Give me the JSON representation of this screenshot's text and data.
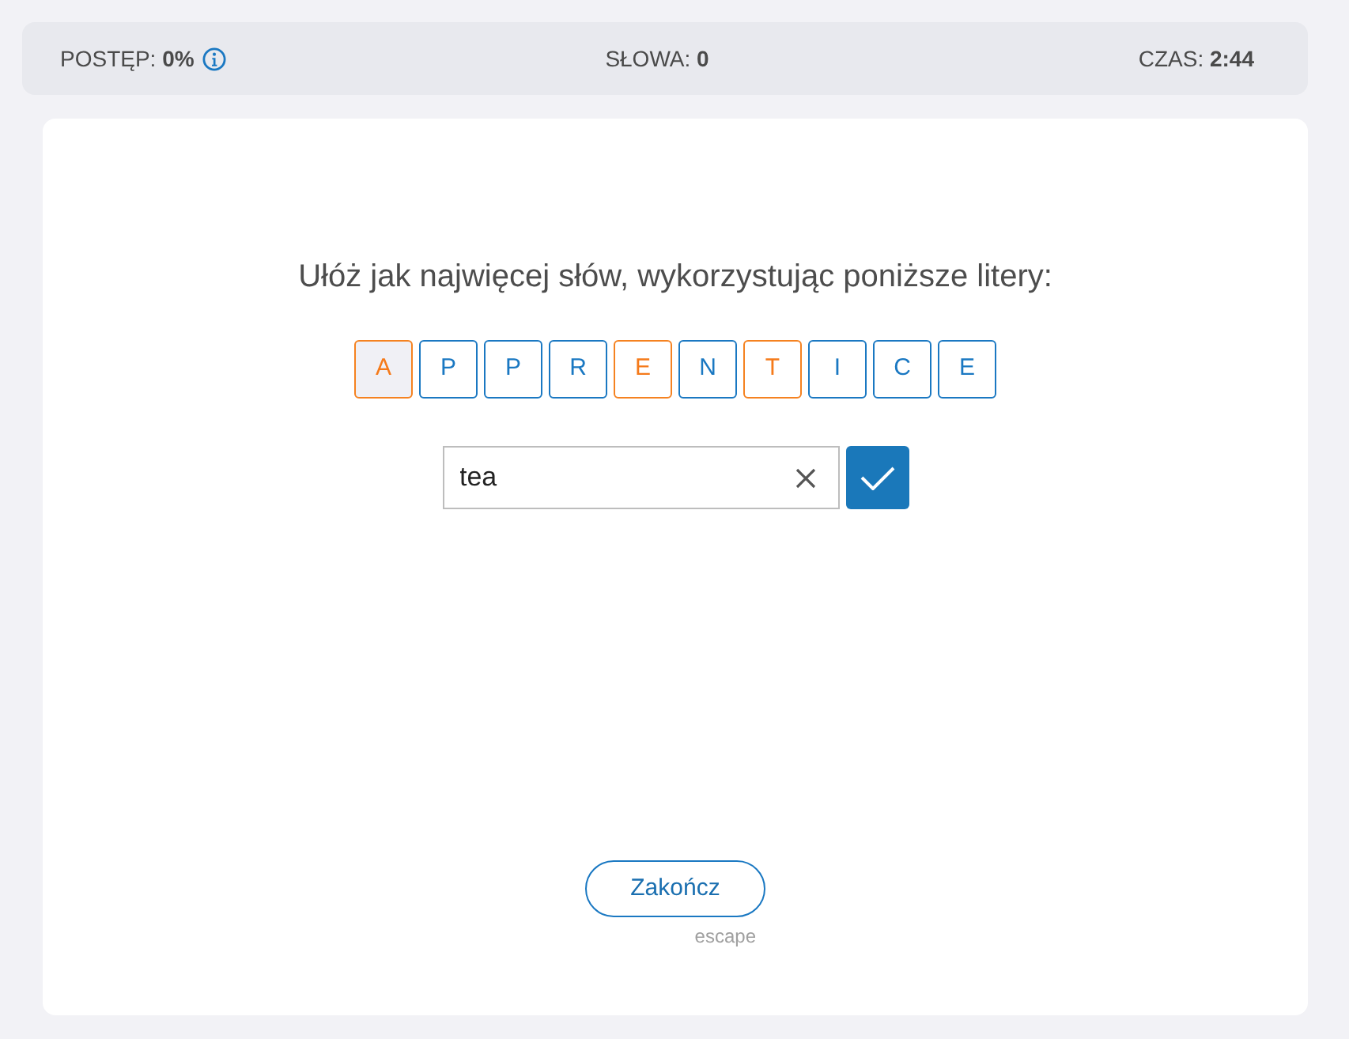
{
  "status_bar": {
    "progress": "POSTĘP: **0%**",
    "words": "SŁOWA: **0**",
    "time": "CZAS: **2:44**"
  },
  "task": {
    "instruction": "Ułóż jak najwięcej słów, wykorzystując poniższe litery:",
    "letters": [
      {
        "letter": "A",
        "used": true,
        "selected": true
      },
      {
        "letter": "P",
        "used": false,
        "selected": false
      },
      {
        "letter": "P",
        "used": false,
        "selected": false
      },
      {
        "letter": "R",
        "used": false,
        "selected": false
      },
      {
        "letter": "E",
        "used": true,
        "selected": false
      },
      {
        "letter": "N",
        "used": false,
        "selected": false
      },
      {
        "letter": "T",
        "used": true,
        "selected": false
      },
      {
        "letter": "I",
        "used": false,
        "selected": false
      },
      {
        "letter": "C",
        "used": false,
        "selected": false
      },
      {
        "letter": "E",
        "used": false,
        "selected": false
      }
    ]
  },
  "answer": {
    "value": "tea"
  },
  "finish": {
    "label": "Zakończ",
    "shortcut": "escape"
  }
}
